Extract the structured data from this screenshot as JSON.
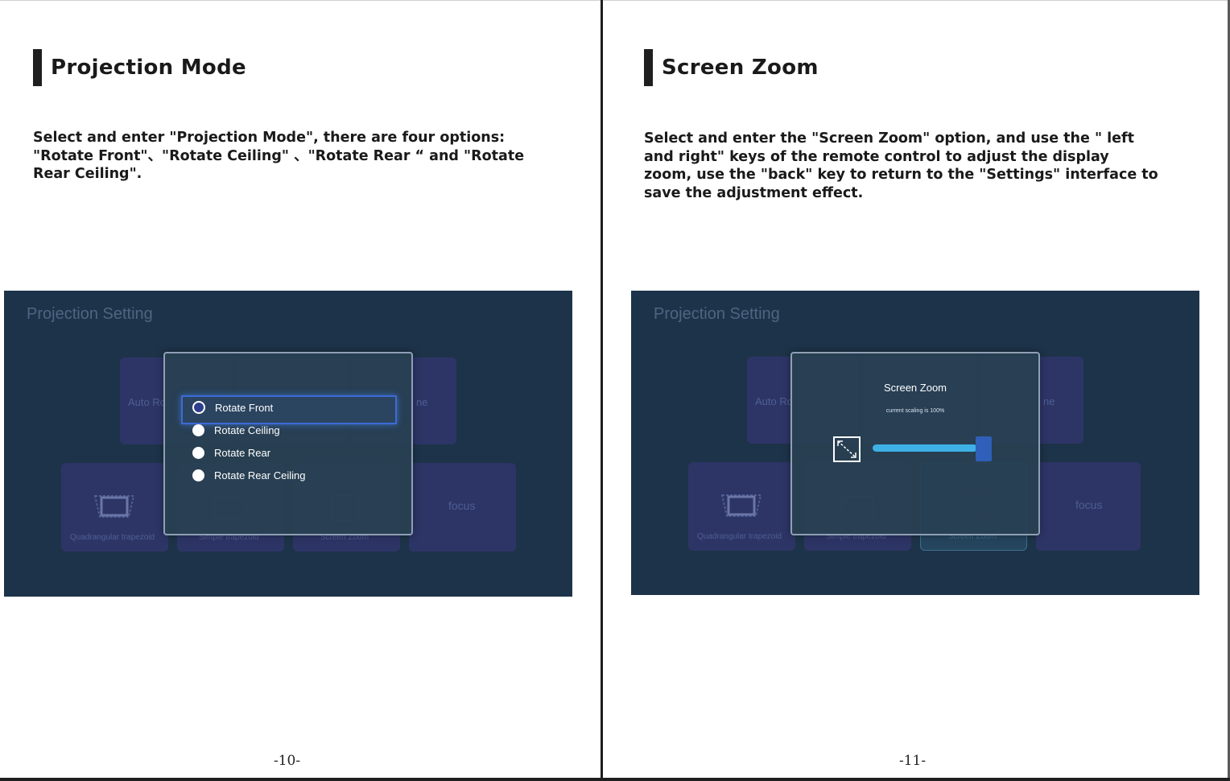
{
  "left_page": {
    "heading": "Projection Mode",
    "body": "Select and enter \"Projection Mode\", there are four options: \"Rotate Front\"、\"Rotate Ceiling\" 、\"Rotate Rear “ and \"Rotate Rear Ceiling\".",
    "page_number": "-10-",
    "screenshot": {
      "title": "Projection Setting",
      "tiles": {
        "auto": "Auto Ro",
        "ne": "ne",
        "quad": "Quadrangular trapezoid",
        "simple": "Simple trapezoid",
        "zoom": "Screen Zoom",
        "focus": "focus"
      },
      "options": [
        "Rotate Front",
        "Rotate Ceiling",
        "Rotate Rear",
        "Rotate Rear Ceiling"
      ],
      "selected_option": "Rotate Front"
    }
  },
  "right_page": {
    "heading": "Screen Zoom",
    "body": "Select and enter the \"Screen Zoom\" option, and use the \" left and right\" keys of the remote control to adjust the display zoom, use the \"back\" key to return to the \"Settings\" interface to save the adjustment effect.",
    "page_number": "-11-",
    "screenshot": {
      "title": "Projection Setting",
      "tiles": {
        "auto": "Auto Ro",
        "ne": "ne",
        "quad": "Quadrangular trapezoid",
        "simple": "Simple trapezoid",
        "zoom": "Screen Zoom",
        "focus": "focus"
      },
      "dialog_title": "Screen Zoom",
      "dialog_subtitle": "current scaling is 100%",
      "zoom_level_fraction": 1.0
    }
  },
  "colors": {
    "screen_bg": "#1d3349",
    "tile": "#2d3566",
    "slider": "#3fb0e6",
    "slider_handle": "#2f5fb8",
    "selection_border": "#3d6bd6"
  }
}
